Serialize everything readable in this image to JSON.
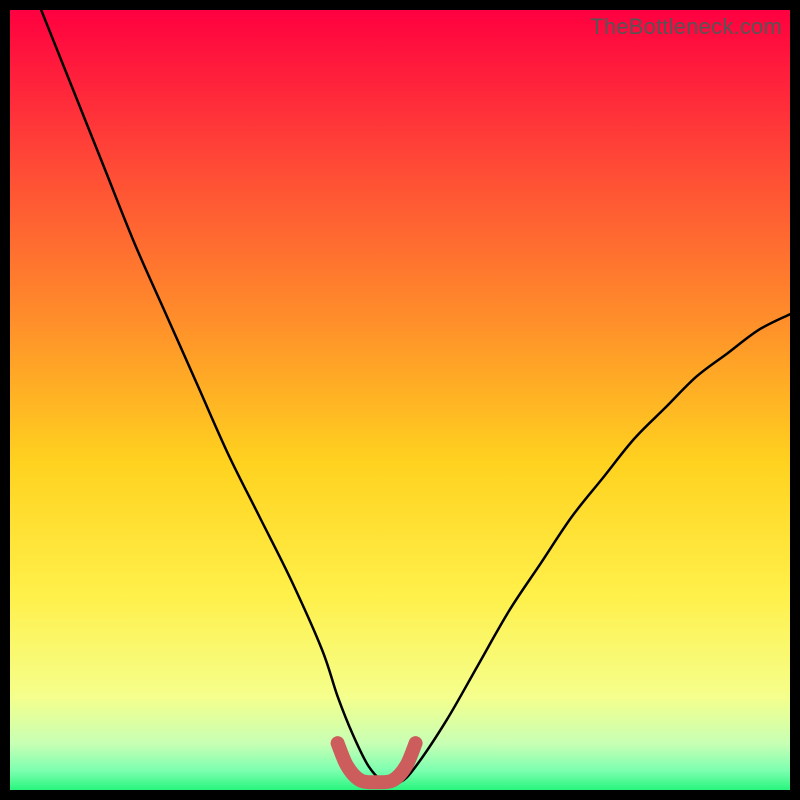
{
  "watermark": "TheBottleneck.com",
  "colors": {
    "frame": "#000000",
    "curve": "#000000",
    "bottom_marker": "#cd5c5c",
    "gradient_top": "#ff0040",
    "gradient_upper_mid": "#ff6a2a",
    "gradient_mid": "#ffd21f",
    "gradient_lower_mid": "#fff66a",
    "gradient_near_bottom": "#e8ffb0",
    "gradient_bottom": "#29f57d"
  },
  "chart_data": {
    "type": "line",
    "title": "",
    "xlabel": "",
    "ylabel": "",
    "xlim": [
      0,
      100
    ],
    "ylim": [
      0,
      100
    ],
    "series": [
      {
        "name": "bottleneck-curve",
        "x": [
          4,
          8,
          12,
          16,
          20,
          24,
          28,
          32,
          36,
          40,
          42,
          44,
          46,
          48,
          50,
          52,
          56,
          60,
          64,
          68,
          72,
          76,
          80,
          84,
          88,
          92,
          96,
          100
        ],
        "y": [
          100,
          90,
          80,
          70,
          61,
          52,
          43,
          35,
          27,
          18,
          12,
          7,
          3,
          1,
          1,
          3,
          9,
          16,
          23,
          29,
          35,
          40,
          45,
          49,
          53,
          56,
          59,
          61
        ]
      },
      {
        "name": "optimal-zone-marker",
        "x": [
          42,
          43,
          44,
          45,
          46,
          47,
          48,
          49,
          50,
          51,
          52
        ],
        "y": [
          6,
          3.5,
          2,
          1.2,
          1,
          1,
          1,
          1.2,
          2,
          3.5,
          6
        ]
      }
    ],
    "background_gradient": {
      "direction": "vertical",
      "stops": [
        {
          "pos": 0.0,
          "color": "#ff0040"
        },
        {
          "pos": 0.2,
          "color": "#ff4a36"
        },
        {
          "pos": 0.4,
          "color": "#ff8f2a"
        },
        {
          "pos": 0.58,
          "color": "#ffd21f"
        },
        {
          "pos": 0.75,
          "color": "#fff04a"
        },
        {
          "pos": 0.88,
          "color": "#f5ff8c"
        },
        {
          "pos": 0.94,
          "color": "#c8ffb4"
        },
        {
          "pos": 0.975,
          "color": "#7dffb0"
        },
        {
          "pos": 1.0,
          "color": "#29f57d"
        }
      ]
    }
  }
}
